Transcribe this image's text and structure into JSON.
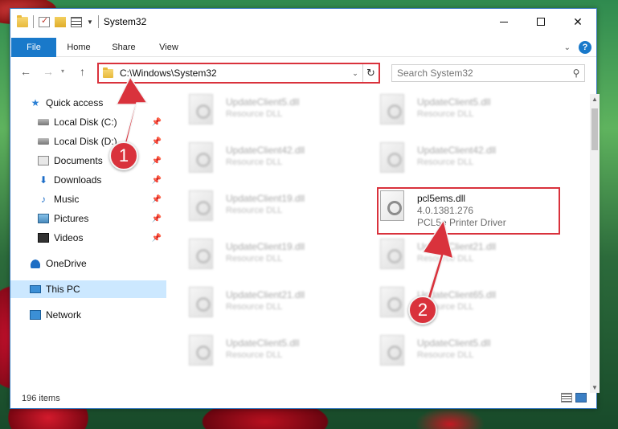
{
  "window": {
    "title": "System32"
  },
  "ribbon": {
    "tabs": [
      "File",
      "Home",
      "Share",
      "View"
    ]
  },
  "address": {
    "path": "C:\\Windows\\System32"
  },
  "search": {
    "placeholder": "Search System32"
  },
  "sidebar": {
    "items": [
      {
        "label": "Quick access",
        "icon": "star-icon",
        "pinned": false
      },
      {
        "label": "Local Disk (C:)",
        "icon": "disk-icon",
        "pinned": true
      },
      {
        "label": "Local Disk (D:)",
        "icon": "disk-icon",
        "pinned": true
      },
      {
        "label": "Documents",
        "icon": "documents-icon",
        "pinned": true
      },
      {
        "label": "Downloads",
        "icon": "downloads-icon",
        "pinned": true
      },
      {
        "label": "Music",
        "icon": "music-icon",
        "pinned": true
      },
      {
        "label": "Pictures",
        "icon": "pictures-icon",
        "pinned": true
      },
      {
        "label": "Videos",
        "icon": "videos-icon",
        "pinned": true
      },
      {
        "label": "OneDrive",
        "icon": "onedrive-icon",
        "pinned": false
      },
      {
        "label": "This PC",
        "icon": "this-pc-icon",
        "pinned": false,
        "selected": true
      },
      {
        "label": "Network",
        "icon": "network-icon",
        "pinned": false
      }
    ]
  },
  "files": {
    "left": [
      {
        "name": "UpdateClient5.dll",
        "type": "Resource DLL"
      },
      {
        "name": "UpdateClient42.dll",
        "type": "Resource DLL"
      },
      {
        "name": "UpdateClient19.dll",
        "type": "Resource DLL"
      },
      {
        "name": "UpdateClient19.dll",
        "type": "Resource DLL"
      },
      {
        "name": "UpdateClient21.dll",
        "type": "Resource DLL"
      },
      {
        "name": "UpdateClient5.dll",
        "type": "Resource DLL"
      }
    ],
    "right": [
      {
        "name": "UpdateClient5.dll",
        "type": "Resource DLL"
      },
      {
        "name": "UpdateClient42.dll",
        "type": "Resource DLL"
      },
      {
        "name": "pcl5ems.dll",
        "version": "4.0.1381.276",
        "type": "PCL5e Printer Driver",
        "focused": true
      },
      {
        "name": "UpdateClient21.dll",
        "type": "Resource DLL"
      },
      {
        "name": "UpdateClient65.dll",
        "type": "Resource DLL"
      },
      {
        "name": "UpdateClient5.dll",
        "type": "Resource DLL"
      }
    ]
  },
  "status": {
    "item_count": "196 items"
  },
  "annotations": {
    "badge1": "1",
    "badge2": "2",
    "color": "#d9323c"
  },
  "colors": {
    "accent": "#1979ca",
    "selected_bg": "#cce8ff"
  }
}
